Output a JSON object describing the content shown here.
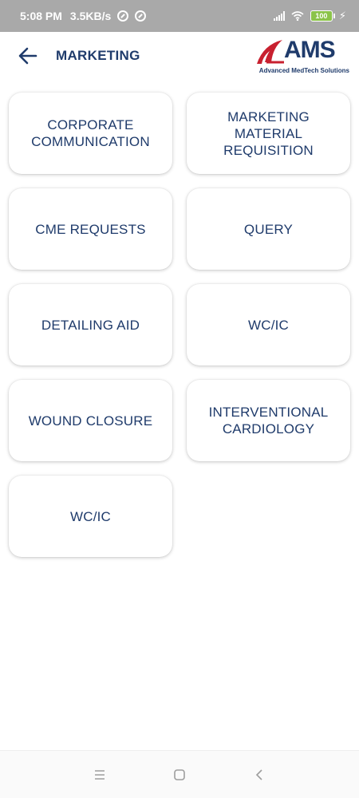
{
  "status_bar": {
    "time": "5:08 PM",
    "net_speed": "3.5KB/s",
    "battery_level": "100",
    "battery_color": "#8bc34a",
    "icons": [
      "circle-slash-icon",
      "circle-slash-icon",
      "signal-icon",
      "wifi-icon",
      "battery-icon",
      "charging-bolt-icon"
    ]
  },
  "header": {
    "back_icon": "back-arrow-icon",
    "title": "MARKETING",
    "logo_text": "AMS",
    "logo_tagline": "Advanced MedTech Solutions",
    "logo_color": "#c8202f",
    "title_color": "#1f3b6b"
  },
  "tiles": [
    {
      "label": "CORPORATE\nCOMMUNICATION"
    },
    {
      "label": "MARKETING MATERIAL\nREQUISITION"
    },
    {
      "label": "CME REQUESTS"
    },
    {
      "label": "QUERY"
    },
    {
      "label": "DETAILING AID"
    },
    {
      "label": "WC/IC"
    },
    {
      "label": "WOUND CLOSURE"
    },
    {
      "label": "INTERVENTIONAL\nCARDIOLOGY"
    },
    {
      "label": "WC/IC"
    }
  ],
  "nav_bar": {
    "icons": [
      "menu-icon",
      "home-square-icon",
      "back-chevron-icon"
    ]
  }
}
